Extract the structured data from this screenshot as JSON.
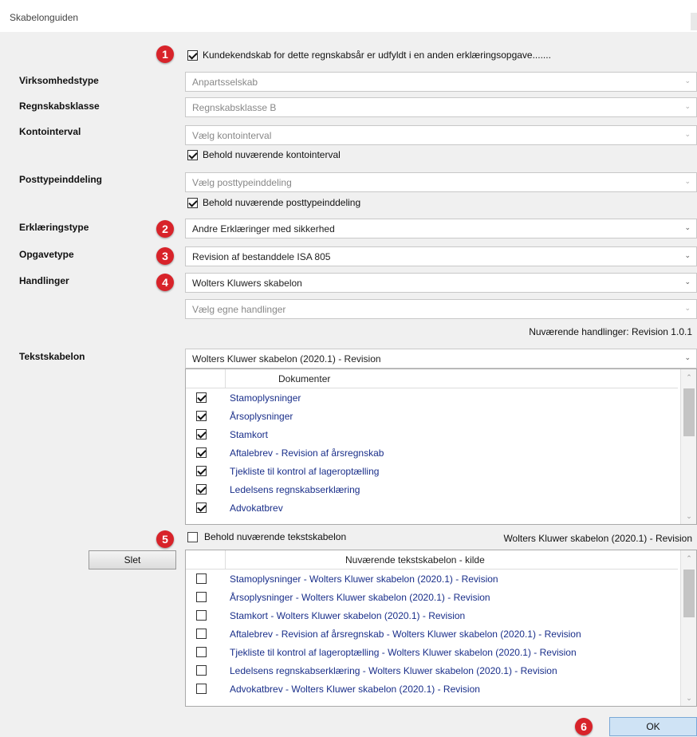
{
  "window": {
    "title": "Skabelonguiden"
  },
  "top_check": {
    "label": "Kundekendskab for dette regnskabsår er udfyldt i en anden erklæringsopgave......."
  },
  "fields": {
    "virksomhedstype": {
      "label": "Virksomhedstype",
      "value": "Anpartsselskab"
    },
    "regnskabsklasse": {
      "label": "Regnskabsklasse",
      "value": "Regnskabsklasse B"
    },
    "kontointerval": {
      "label": "Kontointerval",
      "value": "Vælg kontointerval",
      "keep_label": "Behold nuværende kontointerval"
    },
    "posttypeinddeling": {
      "label": "Posttypeinddeling",
      "value": "Vælg posttypeinddeling",
      "keep_label": "Behold nuværende posttypeinddeling"
    },
    "erklaeringstype": {
      "label": "Erklæringstype",
      "value": "Andre Erklæringer med sikkerhed"
    },
    "opgavetype": {
      "label": "Opgavetype",
      "value": "Revision af bestanddele ISA 805"
    },
    "handlinger": {
      "label": "Handlinger",
      "value": "Wolters Kluwers skabelon",
      "own_value": "Vælg egne handlinger",
      "current_info": "Nuværende handlinger: Revision 1.0.1"
    },
    "tekstskabelon": {
      "label": "Tekstskabelon",
      "value": "Wolters Kluwer skabelon (2020.1) - Revision"
    }
  },
  "documents": {
    "header": "Dokumenter",
    "rows": [
      "Stamoplysninger",
      "Årsoplysninger",
      "Stamkort",
      "Aftalebrev - Revision af årsregnskab",
      "Tjekliste til kontrol af lageroptælling",
      "Ledelsens regnskabserklæring",
      "Advokatbrev"
    ]
  },
  "keep_text": {
    "label": "Behold nuværende tekstskabelon",
    "current": "Wolters Kluwer skabelon (2020.1) - Revision"
  },
  "current_source": {
    "header": "Nuværende tekstskabelon - kilde",
    "rows": [
      "Stamoplysninger  -  Wolters Kluwer skabelon (2020.1) - Revision",
      "Årsoplysninger  -  Wolters Kluwer skabelon (2020.1) - Revision",
      "Stamkort  -  Wolters Kluwer skabelon (2020.1) - Revision",
      "Aftalebrev - Revision af årsregnskab  -  Wolters Kluwer skabelon (2020.1) - Revision",
      "Tjekliste til kontrol af lageroptælling  -  Wolters Kluwer skabelon (2020.1) - Revision",
      "Ledelsens regnskabserklæring  -  Wolters Kluwer skabelon (2020.1) - Revision",
      "Advokatbrev  -  Wolters Kluwer skabelon (2020.1) - Revision"
    ]
  },
  "buttons": {
    "delete": "Slet",
    "ok": "OK"
  },
  "badges": [
    "1",
    "2",
    "3",
    "4",
    "5",
    "6"
  ],
  "colors": {
    "badge": "#d8232a",
    "link_text": "#1a2f8a",
    "ok_button": "#cfe3f5"
  }
}
